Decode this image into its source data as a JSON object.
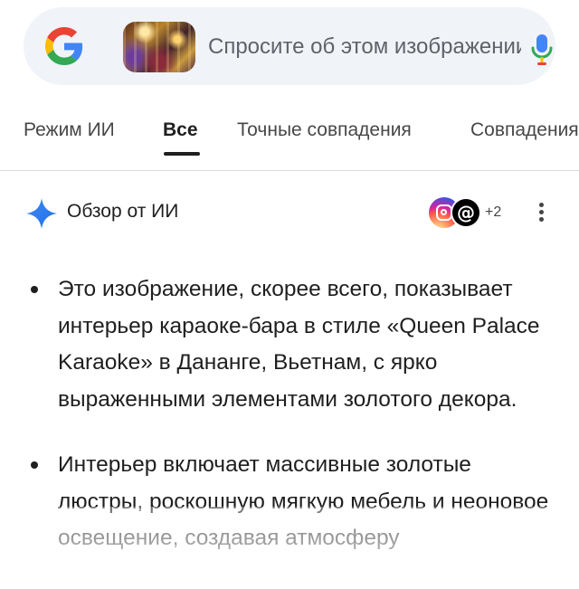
{
  "search": {
    "placeholder": "Спросите об этом изображении",
    "icons": {
      "logo": "google-g-icon",
      "mic": "mic-icon",
      "thumbnail": "karaoke-interior-thumbnail"
    }
  },
  "tabs": [
    {
      "label": "Режим ИИ",
      "active": false
    },
    {
      "label": "Все",
      "active": true
    },
    {
      "label": "Точные совпадения",
      "active": false
    },
    {
      "label": "Совпадения",
      "active": false
    }
  ],
  "ai_overview": {
    "title": "Обзор от ИИ",
    "sources_more": "+2",
    "source_icons": [
      "instagram-icon",
      "threads-icon"
    ],
    "bullets": [
      "Это изображение, скорее всего, показывает интерьер караоке-бара в стиле «Queen Palace Karaoke» в Дананге, Вьетнам, с ярко выраженными элементами золотого декора.",
      "Интерьер включает массивные золотые люстры, роскошную мягкую мебель и неоновое освещение, создавая атмосферу"
    ]
  },
  "colors": {
    "accent": "#4285f4",
    "tab_active": "#1f1f1f",
    "search_bg": "#f0f3f8"
  }
}
